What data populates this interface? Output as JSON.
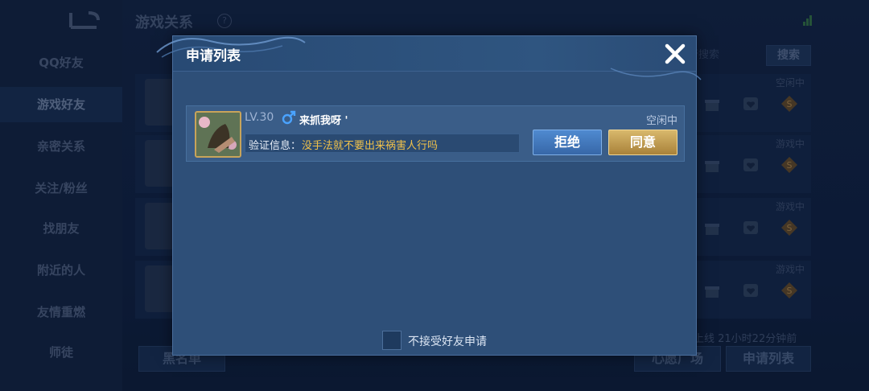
{
  "background": {
    "sidebar": {
      "items": [
        {
          "label": "QQ好友"
        },
        {
          "label": "游戏好友"
        },
        {
          "label": "亲密关系"
        },
        {
          "label": "关注/粉丝"
        },
        {
          "label": "找朋友"
        },
        {
          "label": "附近的人"
        },
        {
          "label": "友情重燃"
        },
        {
          "label": "师徒"
        }
      ],
      "active_index": 1
    },
    "title": "游戏关系",
    "help_glyph": "?",
    "search_placeholder": "行搜索",
    "search_button": "搜索",
    "rows": [
      {
        "status": "空闲中"
      },
      {
        "status": "游戏中"
      },
      {
        "status": "游戏中"
      },
      {
        "status": "游戏中"
      }
    ],
    "footer_note": "上线  21小时22分钟前",
    "buttons": {
      "blacklist": "黑名单",
      "wish_square": "心愿广场",
      "request_list": "申请列表"
    }
  },
  "modal": {
    "title": "申请列表",
    "request": {
      "level": "LV.30",
      "name": "来抓我呀 '",
      "status": "空闲中",
      "verify_label": "验证信息：",
      "verify_text": "没手法就不要出来祸害人行吗",
      "reject_label": "拒绝",
      "accept_label": "同意"
    },
    "checkbox_label": "不接受好友申请"
  },
  "colors": {
    "accent_gold": "#f0c14a",
    "reject_blue": "#4f8ad0",
    "accept_gold": "#c9a458",
    "modal_bg": "#2e4f78"
  }
}
